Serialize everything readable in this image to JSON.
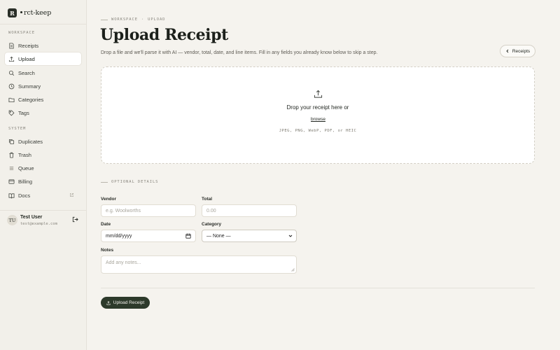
{
  "brand": {
    "logo_letter": "R",
    "name": "rct-keep"
  },
  "sidebar": {
    "sections": [
      {
        "label": "WORKSPACE"
      },
      {
        "label": "SYSTEM"
      }
    ],
    "items": [
      {
        "label": "Receipts",
        "icon": "receipt-icon"
      },
      {
        "label": "Upload",
        "icon": "upload-icon",
        "active": true
      },
      {
        "label": "Search",
        "icon": "search-icon"
      },
      {
        "label": "Summary",
        "icon": "clock-icon"
      },
      {
        "label": "Categories",
        "icon": "folder-icon"
      },
      {
        "label": "Tags",
        "icon": "tag-icon"
      },
      {
        "label": "Duplicates",
        "icon": "copy-icon"
      },
      {
        "label": "Trash",
        "icon": "trash-icon"
      },
      {
        "label": "Queue",
        "icon": "queue-icon"
      },
      {
        "label": "Billing",
        "icon": "card-icon"
      },
      {
        "label": "Docs",
        "icon": "book-icon",
        "external": true
      }
    ],
    "user": {
      "initials": "TU",
      "name": "Test User",
      "email": "test@example.com"
    }
  },
  "breadcrumb": {
    "workspace": "WORKSPACE",
    "separator": "·",
    "page": "UPLOAD"
  },
  "page": {
    "title": "Upload Receipt",
    "subtitle": "Drop a file and we'll parse it with AI — vendor, total, date, and line items. Fill in any fields you already know below to skip a step.",
    "back_button": "Receipts"
  },
  "dropzone": {
    "title": "Drop your receipt here or",
    "browse": "browse",
    "types": "JPEG, PNG, WebP, PDF, or HEIC"
  },
  "optional": {
    "label": "OPTIONAL DETAILS",
    "vendor_label": "Vendor",
    "vendor_placeholder": "e.g. Woolworths",
    "total_label": "Total",
    "total_placeholder": "0.00",
    "date_label": "Date",
    "date_value": "mm/dd/yyyy",
    "category_label": "Category",
    "category_value": "— None —",
    "notes_label": "Notes",
    "notes_placeholder": "Add any notes..."
  },
  "submit_label": "Upload Receipt",
  "colors": {
    "accent": "#2d3a2b",
    "background": "#f5f3ee"
  }
}
